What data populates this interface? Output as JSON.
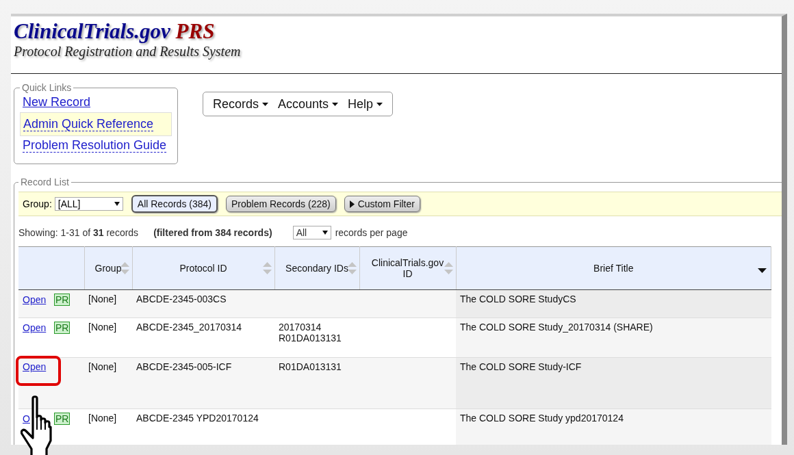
{
  "header": {
    "title": "ClinicalTrials.gov",
    "title_suffix": "PRS",
    "subtitle": "Protocol Registration and Results System"
  },
  "quick_links": {
    "legend": "Quick Links",
    "links": [
      {
        "label": "New Record",
        "kind": "plain",
        "selected": false
      },
      {
        "label": "Admin Quick Reference",
        "kind": "dotted",
        "selected": true
      },
      {
        "label": "Problem Resolution Guide",
        "kind": "dotted",
        "selected": false
      }
    ]
  },
  "menu": [
    "Records",
    "Accounts",
    "Help"
  ],
  "record_list": {
    "legend": "Record List",
    "group_label": "Group:",
    "group_value": "[ALL]",
    "filters": [
      {
        "label": "All Records (384)",
        "kind": "toggle",
        "selected": true
      },
      {
        "label": "Problem Records (228)",
        "kind": "toggle",
        "selected": false
      },
      {
        "label": "Custom Filter",
        "kind": "expander",
        "selected": false
      }
    ],
    "showing": "Showing: 1-31 of **31** records",
    "filtered": "(filtered from 384 records)",
    "per_page_value": "All",
    "per_page_label": "records per page"
  },
  "table": {
    "columns": [
      {
        "sortable": false
      },
      {
        "label": "Group",
        "sortable": true,
        "sorted": false
      },
      {
        "label": "Protocol ID",
        "sortable": true,
        "sorted": false
      },
      {
        "label": "Secondary IDs",
        "sortable": true,
        "sorted": false
      },
      {
        "label": "ClinicalTrials.gov ID",
        "sortable": true,
        "sorted": false
      },
      {
        "label": "Brief Title",
        "sortable": true,
        "sorted": true
      }
    ],
    "rows": [
      {
        "open": "Open",
        "pr_badge": "PR",
        "highlighted": false,
        "group": "[None]",
        "protocol_id": "ABCDE-2345-003CS",
        "secondary_ids": [],
        "nct_id": "",
        "brief_title": "The COLD SORE StudyCS"
      },
      {
        "open": "Open",
        "pr_badge": "PR",
        "highlighted": false,
        "group": "[None]",
        "protocol_id": "ABCDE-2345_20170314",
        "secondary_ids": [
          "20170314",
          "R01DA013131"
        ],
        "nct_id": "",
        "brief_title": "The COLD SORE Study_20170314 (SHARE)"
      },
      {
        "open": "Open",
        "pr_badge": "",
        "highlighted": true,
        "group": "[None]",
        "protocol_id": "ABCDE-2345-005-ICF",
        "secondary_ids": [
          "R01DA013131"
        ],
        "nct_id": "",
        "brief_title": "The COLD SORE Study-ICF"
      },
      {
        "open": "O",
        "pr_badge": "PR",
        "highlighted": false,
        "group": "[None]",
        "protocol_id": "ABCDE-2345 YPD20170124",
        "secondary_ids": [],
        "nct_id": "",
        "brief_title": "The COLD SORE Study ypd20170124"
      }
    ]
  },
  "footer_pointer": {
    "kind": "hand"
  }
}
